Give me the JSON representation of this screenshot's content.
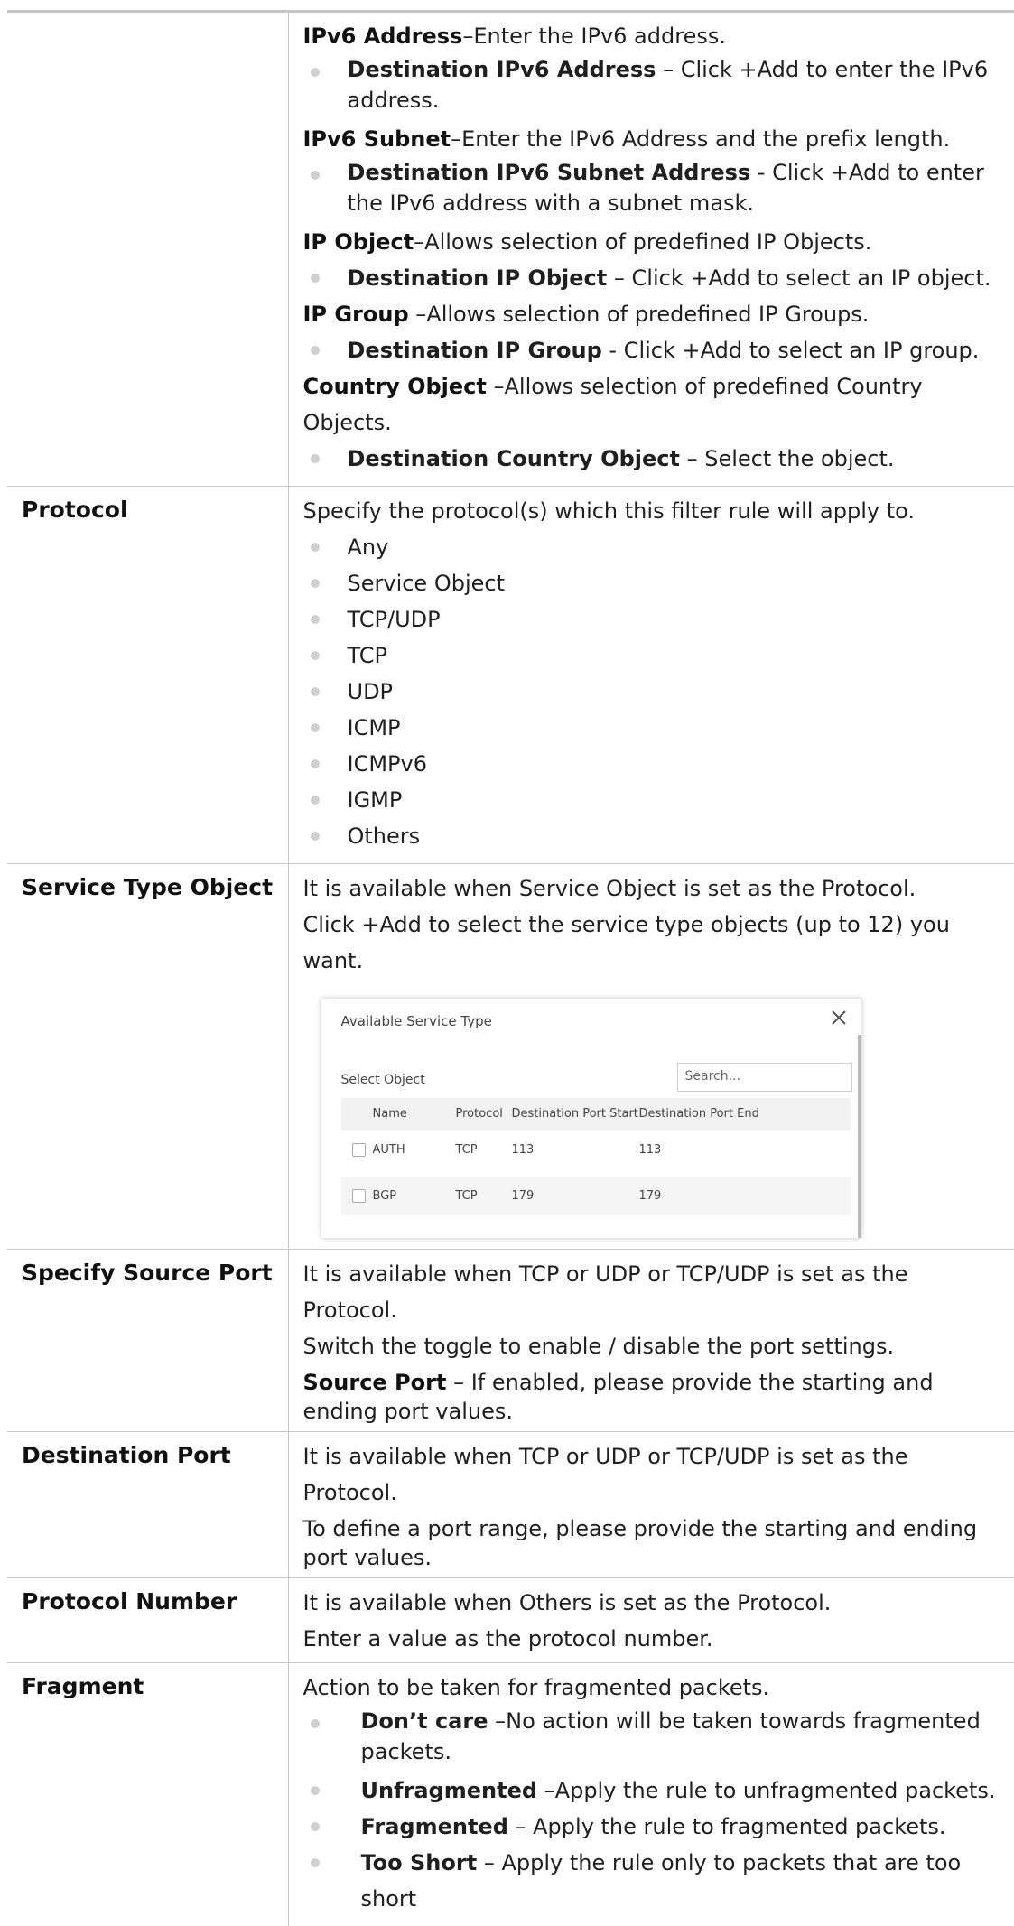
{
  "section_dest": {
    "items": [
      {
        "type": "para",
        "term": "IPv6 Address",
        "text": "–Enter the IPv6 address."
      },
      {
        "type": "bullet",
        "term": "Destination IPv6 Address",
        "text": " – Click +Add to enter the IPv6 address."
      },
      {
        "type": "para",
        "term": "IPv6 Subnet",
        "text": "–Enter the IPv6 Address and the prefix length."
      },
      {
        "type": "bullet",
        "term": "Destination IPv6 Subnet Address",
        "text": " - Click +Add to enter the IPv6 address with a subnet mask."
      },
      {
        "type": "para",
        "term": "IP Object",
        "text": "–Allows selection of predefined IP Objects."
      },
      {
        "type": "bullet",
        "term": "Destination IP Object",
        "text": " – Click +Add to select an IP object."
      },
      {
        "type": "para",
        "term": "IP Group",
        "text": " –Allows selection of predefined IP Groups."
      },
      {
        "type": "bullet",
        "term": "Destination IP Group",
        "text": " - Click +Add to select an IP group."
      },
      {
        "type": "para",
        "term": "Country Object",
        "text": " –Allows selection of predefined Country Objects."
      },
      {
        "type": "bullet",
        "term": "Destination Country Object",
        "text": " – Select the object."
      }
    ]
  },
  "protocol": {
    "label": "Protocol",
    "intro": "Specify the protocol(s) which this filter rule will apply to.",
    "options": [
      "Any",
      "Service Object",
      "TCP/UDP",
      "TCP",
      "UDP",
      "ICMP",
      "ICMPv6",
      "IGMP",
      "Others"
    ]
  },
  "service_type": {
    "label": "Service Type Object",
    "line1": "It is available when Service Object is set as the Protocol.",
    "line2": "Click +Add to select the service type objects (up to 12) you want.",
    "dialog": {
      "title": "Available Service Type",
      "select_label": "Select Object",
      "search_placeholder": "Search...",
      "columns": [
        "Name",
        "Protocol",
        "Destination Port Start",
        "Destination Port End"
      ],
      "rows": [
        {
          "name": "AUTH",
          "protocol": "TCP",
          "start": "113",
          "end": "113"
        },
        {
          "name": "BGP",
          "protocol": "TCP",
          "start": "179",
          "end": "179"
        }
      ]
    }
  },
  "source_port": {
    "label": "Specify Source Port",
    "line1": "It is available when TCP or UDP or TCP/UDP is set as the Protocol.",
    "line2": "Switch the toggle to enable / disable the port settings.",
    "term": "Source Port",
    "text": " – If enabled, please provide the starting and ending port values."
  },
  "dest_port": {
    "label": "Destination Port",
    "line1": "It is available when TCP or UDP or TCP/UDP is set as the Protocol.",
    "line2": "To define a port range, please provide the starting and ending port values."
  },
  "protocol_number": {
    "label": "Protocol Number",
    "line1": "It is available when Others is set as the Protocol.",
    "line2": "Enter a value as the protocol number."
  },
  "fragment": {
    "label": "Fragment",
    "intro": "Action to be taken for fragmented packets.",
    "options": [
      {
        "term": "Don’t care",
        "text": " –No action will be taken towards fragmented packets."
      },
      {
        "term": "Unfragmented",
        "text": " –Apply the rule to unfragmented packets."
      },
      {
        "term": "Fragmented",
        "text": " – Apply the rule to fragmented packets."
      },
      {
        "term": "Too Short",
        "text": " – Apply the rule only to packets that are too short"
      }
    ]
  }
}
